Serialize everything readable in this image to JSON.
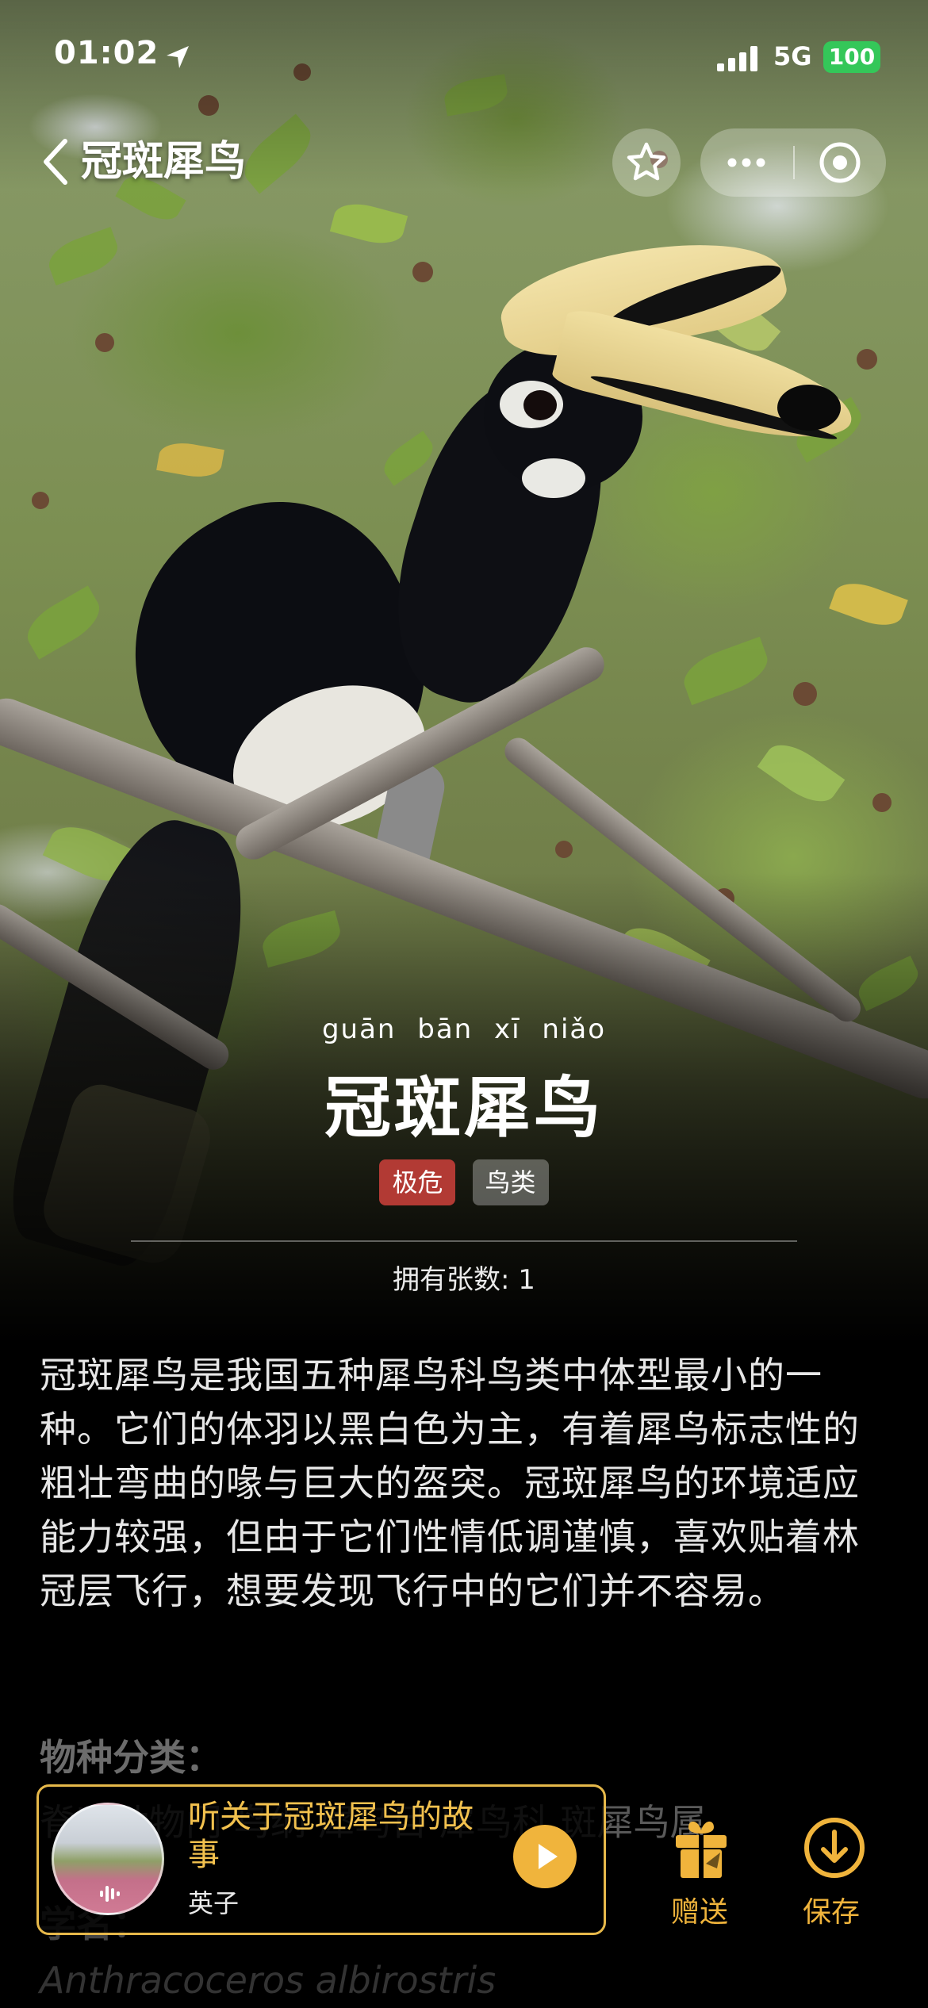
{
  "status_bar": {
    "time": "01:02",
    "network": "5G",
    "battery": "100"
  },
  "nav": {
    "title": "冠斑犀鸟"
  },
  "species": {
    "pinyin": "guān bān xī niǎo",
    "name": "冠斑犀鸟",
    "tags": [
      "极危",
      "鸟类"
    ],
    "count_text": "拥有张数: 1",
    "description": "冠斑犀鸟是我国五种犀鸟科鸟类中体型最小的一种。它们的体羽以黑白色为主，有着犀鸟标志性的粗壮弯曲的喙与巨大的盔突。冠斑犀鸟的环境适应能力较强，但由于它们性情低调谨慎，喜欢贴着林冠层飞行，想要发现飞行中的它们并不容易。",
    "classification_label": "物种分类：",
    "classification_value": "脊索动物门 鸟纲 犀鸟目 犀鸟科 斑犀鸟属",
    "scientific_label": "学名：",
    "scientific_value": "Anthracoceros albirostris"
  },
  "audio": {
    "title": "听关于冠斑犀鸟的故事",
    "author": "英子"
  },
  "actions": {
    "gift_label": "赠送",
    "save_label": "保存"
  },
  "colors": {
    "accent": "#f0b43c",
    "danger_tag": "#b23a34",
    "battery": "#34c759"
  }
}
